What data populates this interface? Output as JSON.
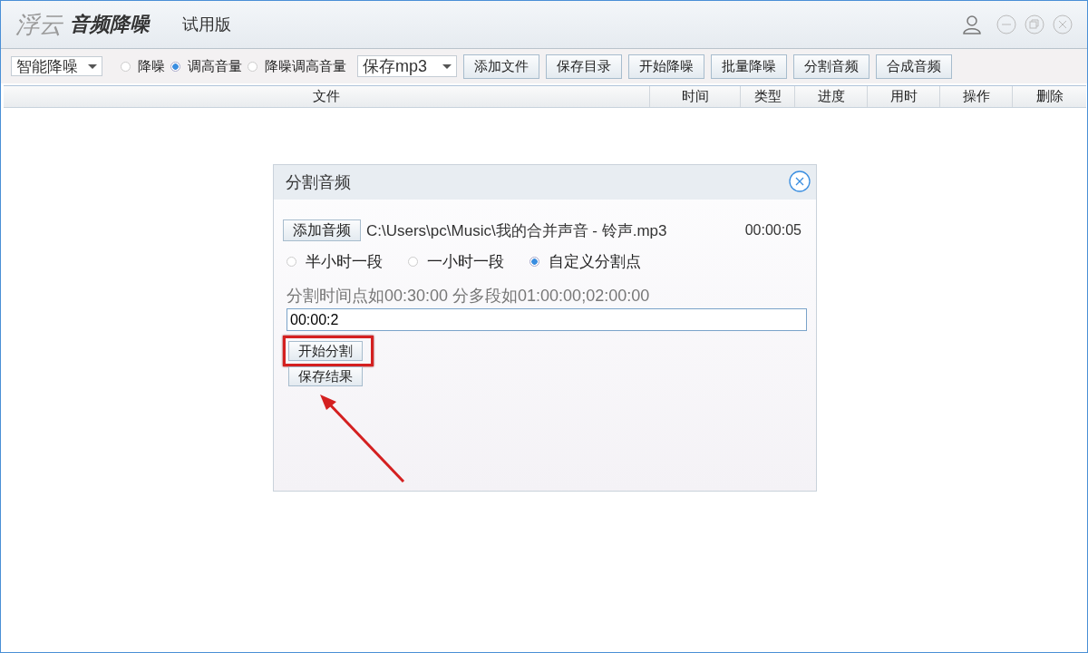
{
  "app": {
    "logo_light": "浮云",
    "logo_dark": "音频降噪",
    "edition": "试用版"
  },
  "toolbar": {
    "mode_select": "智能降噪",
    "options": [
      {
        "label": "降噪",
        "selected": false
      },
      {
        "label": "调高音量",
        "selected": true
      },
      {
        "label": "降噪调高音量",
        "selected": false
      }
    ],
    "format_select": "保存mp3",
    "buttons": [
      "添加文件",
      "保存目录",
      "开始降噪",
      "批量降噪",
      "分割音频",
      "合成音频"
    ]
  },
  "table": {
    "columns": [
      "文件",
      "时间",
      "类型",
      "进度",
      "用时",
      "操作",
      "删除"
    ]
  },
  "dialog": {
    "title": "分割音频",
    "add_button": "添加音频",
    "file_path": "C:\\Users\\pc\\Music\\我的合并声音 - 铃声.mp3",
    "duration": "00:00:05",
    "split_options": [
      {
        "label": "半小时一段",
        "selected": false
      },
      {
        "label": "一小时一段",
        "selected": false
      },
      {
        "label": "自定义分割点",
        "selected": true
      }
    ],
    "hint": "分割时间点如00:30:00 分多段如01:00:00;02:00:00",
    "split_points": "00:00:2",
    "buttons": [
      {
        "label": "开始分割",
        "highlighted": true
      },
      {
        "label": "保存结果",
        "highlighted": false
      }
    ]
  }
}
